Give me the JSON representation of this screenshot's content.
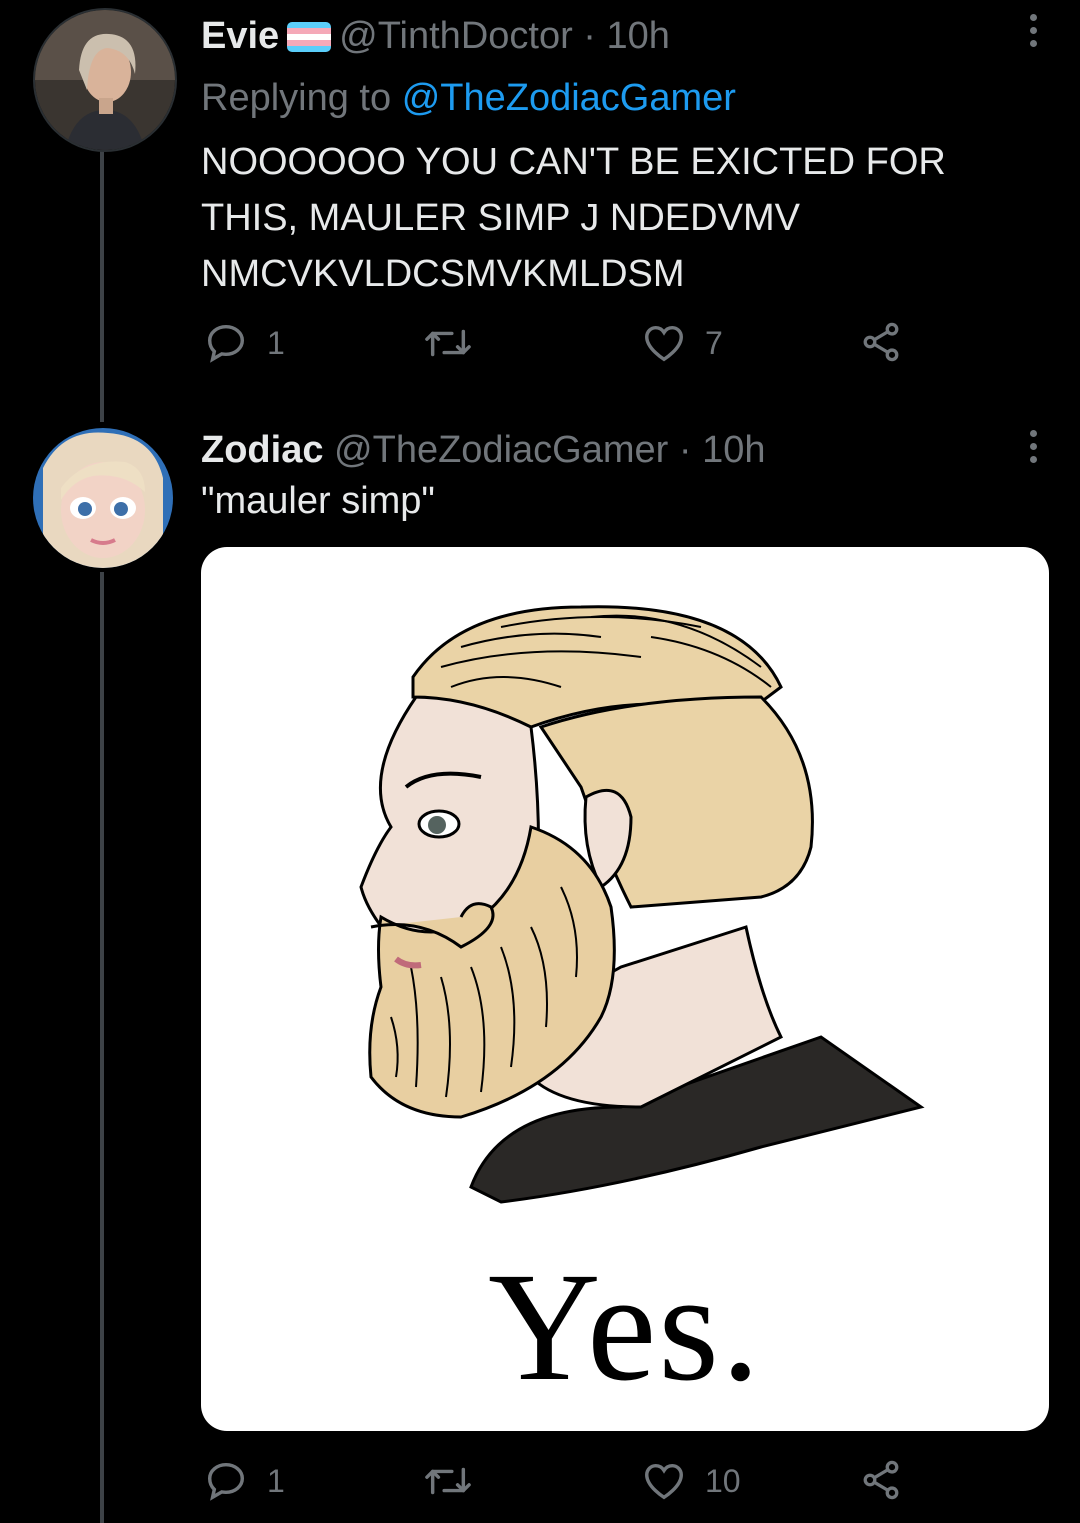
{
  "tweets": [
    {
      "display_name": "Evie",
      "handle": "@TinthDoctor",
      "time": "10h",
      "replying_prefix": "Replying to",
      "replying_to": "@TheZodiacGamer",
      "text": "NOOOOOO YOU CAN'T BE EXICTED FOR\nTHIS, MAULER SIMP J NDEDVMV\nNMCVKVLDCSMVKMLDSM",
      "replies": "1",
      "retweets": "",
      "likes": "7"
    },
    {
      "display_name": "Zodiac",
      "handle": "@TheZodiacGamer",
      "time": "10h",
      "text": "\"mauler simp\"",
      "media_caption": "Yes.",
      "replies": "1",
      "retweets": "",
      "likes": "10"
    }
  ],
  "colors": {
    "background": "#000000",
    "muted": "#71767b",
    "link": "#1d9bf0",
    "text": "#e7e9ea"
  },
  "icons": [
    "reply-icon",
    "retweet-icon",
    "like-icon",
    "share-icon",
    "more-icon",
    "trans-flag-icon"
  ]
}
